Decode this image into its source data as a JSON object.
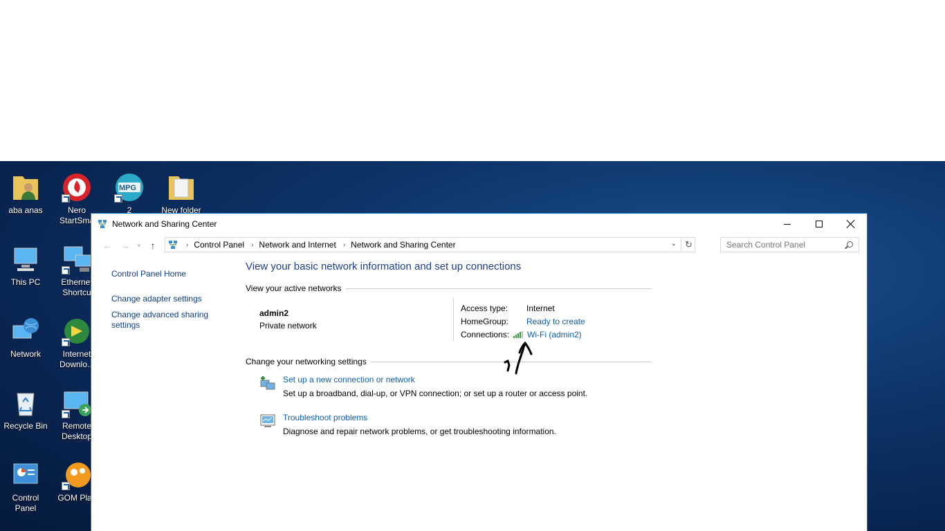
{
  "desktop": {
    "icons": [
      {
        "label": "aba anas"
      },
      {
        "label": "Nero StartSmart"
      },
      {
        "label": "2"
      },
      {
        "label": "New folder"
      },
      {
        "label": "This PC"
      },
      {
        "label": "Ethernet Shortcut"
      },
      {
        "label": "Network"
      },
      {
        "label": "Internet Downlo..."
      },
      {
        "label": "Recycle Bin"
      },
      {
        "label": "Remote Desktop"
      },
      {
        "label": "Control Panel"
      },
      {
        "label": "GOM Player"
      }
    ],
    "mpg_badge": "MPG"
  },
  "window": {
    "title": "Network and Sharing Center",
    "breadcrumb": [
      "Control Panel",
      "Network and Internet",
      "Network and Sharing Center"
    ],
    "search": {
      "placeholder": "Search Control Panel"
    },
    "left_links": [
      "Control Panel Home",
      "Change adapter settings",
      "Change advanced sharing settings"
    ],
    "heading": "View your basic network information and set up connections",
    "active_networks": {
      "section_title": "View your active networks",
      "name": "admin2",
      "type": "Private network",
      "access_type_label": "Access type:",
      "access_type_value": "Internet",
      "homegroup_label": "HomeGroup:",
      "homegroup_value": "Ready to create",
      "connections_label": "Connections:",
      "connections_value": "Wi-Fi (admin2)"
    },
    "networking_settings": {
      "section_title": "Change your networking settings",
      "tasks": [
        {
          "title": "Set up a new connection or network",
          "desc": "Set up a broadband, dial-up, or VPN connection; or set up a router or access point."
        },
        {
          "title": "Troubleshoot problems",
          "desc": "Diagnose and repair network problems, or get troubleshooting information."
        }
      ]
    }
  },
  "colors": {
    "accent": "#1883d7",
    "link": "#0c5bb3",
    "heading": "#1e3d8f"
  }
}
